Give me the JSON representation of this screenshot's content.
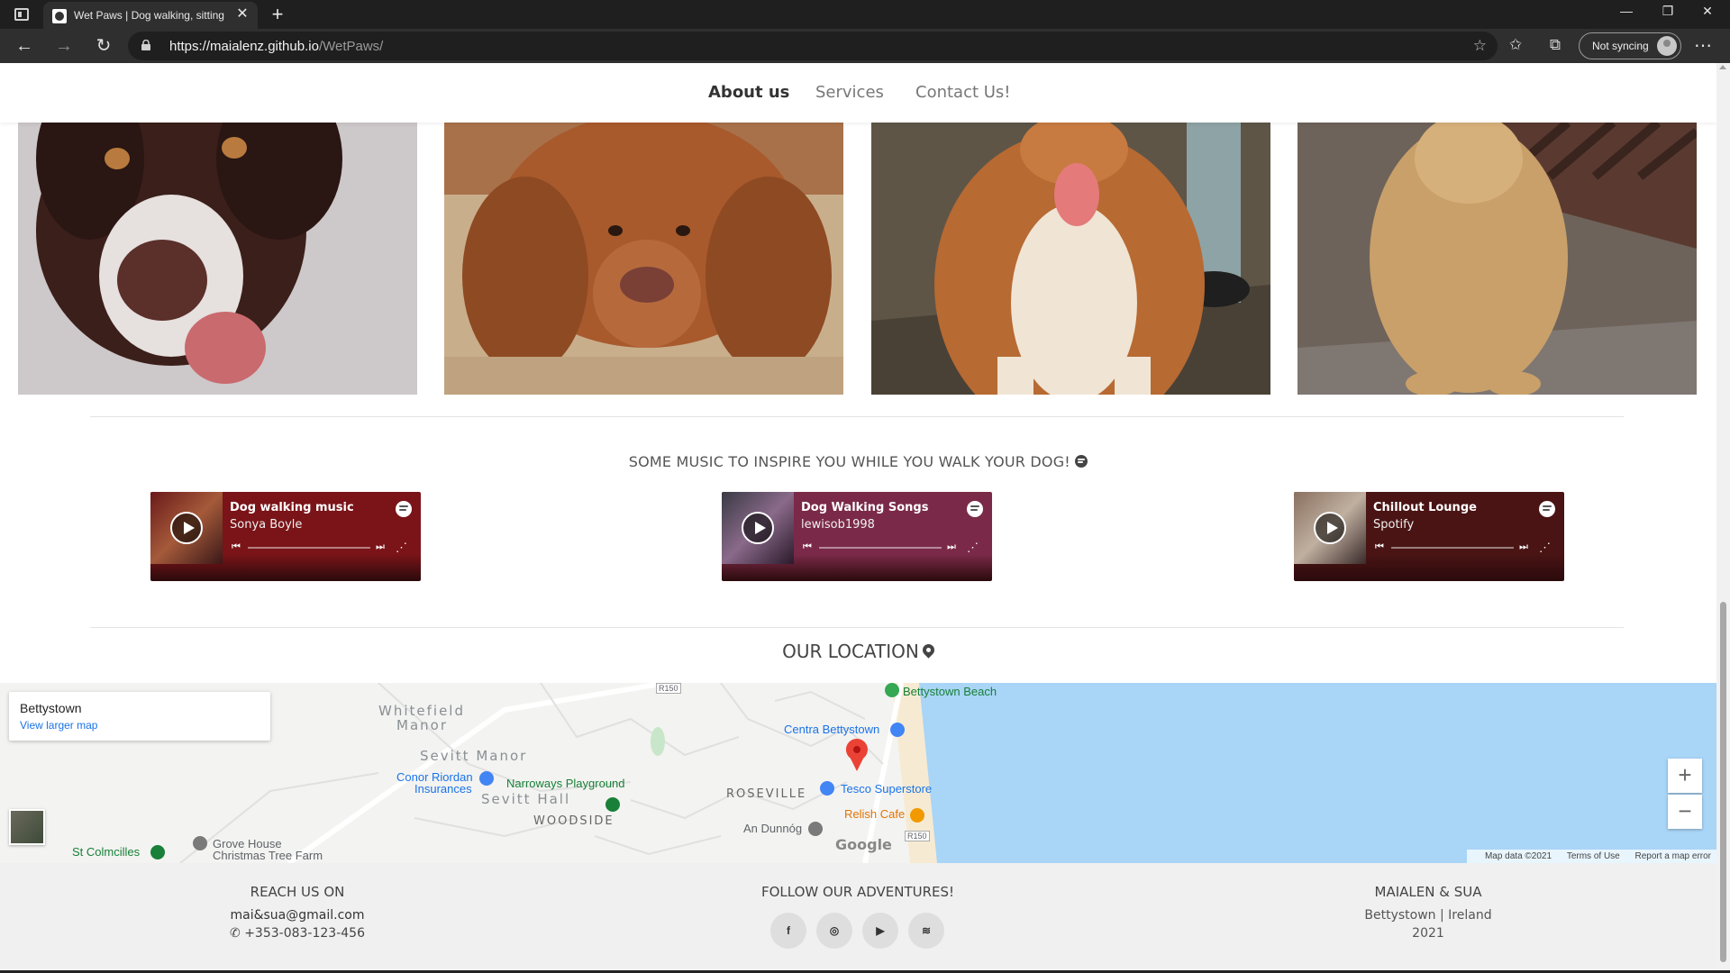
{
  "browser": {
    "tab_title": "Wet Paws | Dog walking, sitting a",
    "url_host": "https://maialenz.github.io",
    "url_path": "/WetPaws/",
    "sync_label": "Not syncing",
    "icons": {
      "back": "back-arrow-icon",
      "forward": "forward-arrow-icon",
      "reload": "reload-icon",
      "lock": "lock-icon",
      "favorite": "star-add-icon",
      "favorites": "favorites-icon",
      "collections": "collections-icon",
      "more": "more-icon"
    }
  },
  "site_nav": {
    "items": [
      {
        "label": "About us",
        "active": true
      },
      {
        "label": "Services",
        "active": false
      },
      {
        "label": "Contact Us!",
        "active": false
      }
    ]
  },
  "gallery": {
    "photos": [
      {
        "name": "dog-photo-1",
        "subject": "brown and white spaniel"
      },
      {
        "name": "dog-photo-2",
        "subject": "ginger dog lying on sand"
      },
      {
        "name": "dog-photo-3",
        "subject": "corgi sitting on pavement"
      },
      {
        "name": "dog-photo-4",
        "subject": "golden dog sitting by fence"
      }
    ]
  },
  "music": {
    "heading": "SOME MUSIC TO INSPIRE YOU WHILE YOU WALK YOUR DOG!",
    "players": [
      {
        "title": "Dog walking music",
        "author": "Sonya Boyle",
        "color": "#7a1418"
      },
      {
        "title": "Dog Walking Songs",
        "author": "lewisob1998",
        "color": "#7a2a48"
      },
      {
        "title": "Chillout Lounge",
        "author": "Spotify",
        "color": "#4a1414"
      }
    ]
  },
  "location": {
    "heading": "OUR LOCATION",
    "card": {
      "title": "Bettystown",
      "link": "View larger map"
    },
    "labels": {
      "whitefield": "Whitefield",
      "manor": "Manor",
      "sevitt_manor": "Sevitt Manor",
      "sevitt_hall": "Sevitt Hall",
      "woodside": "WOODSIDE",
      "roseville": "ROSEVILLE",
      "beach": "Bettystown Beach",
      "centra": "Centra Bettystown",
      "tesco": "Tesco Superstore",
      "relish": "Relish Cafe",
      "conor_1": "Conor Riordan",
      "conor_2": "Insurances",
      "narroways": "Narroways Playground",
      "an_dunnog": "An Dunnóg",
      "grove_1": "Grove House",
      "grove_2": "Christmas Tree Farm",
      "colmcilles": "St Colmcilles",
      "road_r150a": "R150",
      "road_r150b": "R150",
      "google": "Google"
    },
    "footer": {
      "data": "Map data ©2021",
      "terms": "Terms of Use",
      "report": "Report a map error"
    },
    "zoom_in": "+",
    "zoom_out": "−"
  },
  "footer": {
    "reach": {
      "heading": "REACH US ON",
      "email": "mai&sua@gmail.com",
      "phone": "+353-083-123-456"
    },
    "follow": {
      "heading": "FOLLOW OUR ADVENTURES!",
      "socials": [
        "facebook-icon",
        "instagram-icon",
        "youtube-icon",
        "spotify-icon"
      ]
    },
    "about": {
      "heading": "MAIALEN & SUA",
      "place": "Bettystown | Ireland",
      "year": "2021"
    }
  }
}
